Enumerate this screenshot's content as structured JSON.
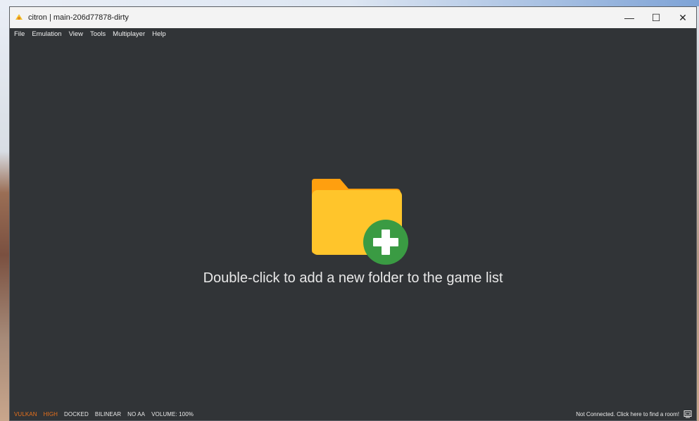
{
  "window": {
    "title": "citron | main-206d77878-dirty",
    "controls": {
      "minimize": "—",
      "maximize": "☐",
      "close": "✕"
    }
  },
  "menu": [
    "File",
    "Emulation",
    "View",
    "Tools",
    "Multiplayer",
    "Help"
  ],
  "main": {
    "hint": "Double-click to add a new folder to the game list",
    "icon": "add-folder-icon"
  },
  "status": {
    "renderer": "VULKAN",
    "accuracy": "HIGH",
    "dock": "DOCKED",
    "filter": "BILINEAR",
    "aa": "NO AA",
    "volume": "VOLUME: 100%",
    "network": "Not Connected. Click here to find a room!"
  },
  "colors": {
    "background": "#313437",
    "folder": "#FFC52B",
    "folder_tab": "#FF9F0F",
    "plus_circle": "#3A9B43",
    "status_warning": "#E8711B"
  }
}
